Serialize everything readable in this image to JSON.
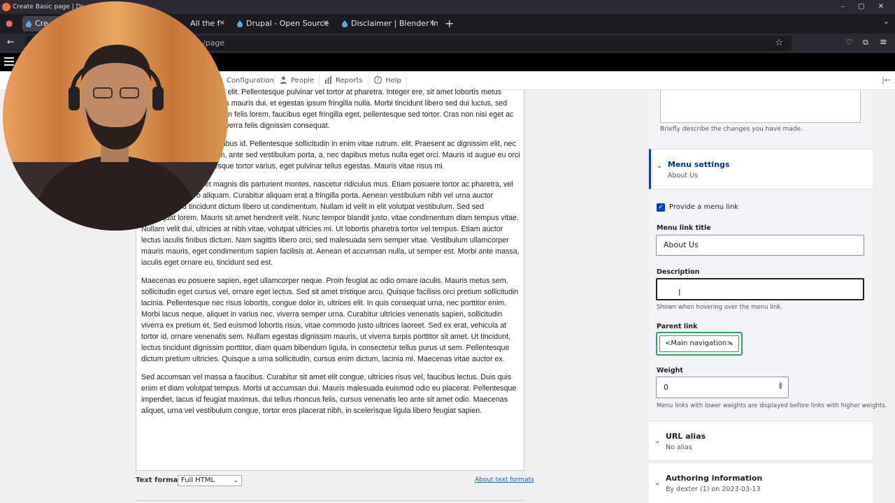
{
  "browser": {
    "title": "Create Basic page | Dr... — Mozilla Firefox",
    "tabs": [
      {
        "label": "Cre",
        "active": true
      },
      {
        "label": "All the f",
        "active": false
      },
      {
        "label": "Drupal - Open Source C",
        "active": false
      },
      {
        "label": "Disclaimer | Blender Inc",
        "active": false
      }
    ],
    "url": "/page"
  },
  "toolbar": {
    "items": [
      {
        "label": "Configuration",
        "icon": "wrench-icon"
      },
      {
        "label": "People",
        "icon": "person-icon"
      },
      {
        "label": "Reports",
        "icon": "bar-chart-icon"
      },
      {
        "label": "Help",
        "icon": "help-icon"
      }
    ]
  },
  "editor": {
    "paragraphs": [
      "et, consectetur adipiscing elit. Pellentesque pulvinar vel tortor at pharetra. Integer ere, sit amet lobortis metus posuere. Vivamus dapibus mauris dui, et egestas ipsum fringilla nulla. Morbi tincidunt libero sed dui luctus, sed molestie felis sagittis. etiam felis lorem, faucibus eget fringilla eget, pellentesque sed tortor. Cras non nisi eget ac mauris. Nullam ac urna viverra felis dignissim consequat.",
      "eget scelerisque dui faucibus id. Pellentesque sollicitudin in enim vitae rutrum. elit. Praesent ac dignissim elit, nec rutrum sem. Nunc dictum, ante sed vestibulum porta, a, nec dapibus metus nulla eget orci. Mauris id augue eu orci tempor varius. Pellentesque tortor varius, eget pulvinar tellus egestas. Mauris vitae risus mi.",
      "natoque penatibus et magnis dis parturient montes, nascetur ridiculus mus. Etiam posuere tortor ac pharetra, vel ullamcorper libero aliquam. Curabitur aliquam erat a fringilla porta. Aenean vestibulum nibh vel urna auctor tincidunt. Sed tincidunt dictum libero ut condimentum. Nullam id velit in elit volutpat vestibulum. Sed sed consequat lorem. Mauris sit amet hendrerit velit. Nunc tempor blandit justo, vitae condimentum diam tempus vitae. Nullam velit dui, ultricies at nibh vitae, volutpat ultricies mi. Ut lobortis pharetra tortor vel tempus. Etiam auctor lectus iaculis finibus dictum. Nam sagittis libero orci, sed malesuada sem semper vitae. Vestibulum ullamcorper mauris mauris, eget condimentum sapien facilisis at. Aenean et accumsan nulla, ut semper est. Morbi ante massa, iaculis eget ornare eu, tincidunt sed est.",
      "Maecenas eu posuere sapien, eget ullamcorper neque. Proin feugiat ac odio ornare iaculis. Mauris metus sem, sollicitudin eget cursus vel, ornare eget lectus. Sed sit amet tristique arcu. Quisque facilisis orci pretium sollicitudin lacinia. Pellentesque nec risus lobortis, congue dolor in, ultrices elit. In quis consequat urna, nec porttitor enim. Morbi lacus neque, aliquet in varius nec, viverra semper urna. Curabitur ultricies venenatis sapien, sollicitudin viverra ex pretium et. Sed euismod lobortis risus, vitae commodo justo ultrices laoreet. Sed ex erat, vehicula at tortor id, ornare venenatis sem. Nullam egestas dignissim mauris, ut viverra turpis porttitor sit amet. Ut tincidunt, lectus tincidunt dignissim porttitor, diam quam bibendum ligula, in consectetur tellus purus ut sem. Pellentesque dictum pretium ultricies. Quisque a urna sollicitudin, cursus enim dictum, lacinia mi. Maecenas vitae auctor ex.",
      "Sed accumsan vel massa a faucibus. Curabitur sit amet elit congue, ultricies risus vel, faucibus lectus. Duis quis enim et diam volutpat tempus. Morbi ut accumsan dui. Mauris malesuada euismod odio eu placerat. Pellentesque imperdiet, lacus id feugiat maximus, dui tellus rhoncus felis, cursus venenatis leo ante sit amet odio. Maecenas aliquet, urna vel vestibulum congue, tortor eros placerat nibh, in scelerisque ligula libero feugiat sapien."
    ],
    "text_format_label": "Text format",
    "text_format_value": "Full HTML",
    "about_formats": "About text formats"
  },
  "sidebar": {
    "revision_help": "Briefly describe the changes you have made.",
    "menu_settings": {
      "title": "Menu settings",
      "summary": "About Us",
      "provide_label": "Provide a menu link",
      "provide_checked": true,
      "title_label": "Menu link title",
      "title_value": "About Us",
      "description_label": "Description",
      "description_value": "",
      "description_help": "Shown when hovering over the menu link.",
      "parent_label": "Parent link",
      "parent_value": "<Main navigation>",
      "weight_label": "Weight",
      "weight_value": "0",
      "weight_help": "Menu links with lower weights are displayed before links with higher weights."
    },
    "url_alias": {
      "title": "URL alias",
      "summary": "No alias"
    },
    "authoring": {
      "title": "Authoring information",
      "summary": "By dexter (1) on 2023-03-13"
    }
  },
  "colors": {
    "accent": "#003ecc",
    "focus_green": "#26a769",
    "drupal_bar": "#000000"
  }
}
